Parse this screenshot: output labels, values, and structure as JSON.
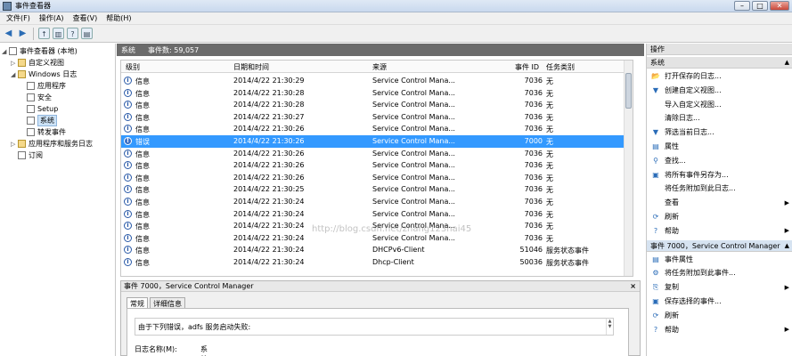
{
  "window": {
    "title": "事件查看器"
  },
  "menu": [
    "文件(F)",
    "操作(A)",
    "查看(V)",
    "帮助(H)"
  ],
  "tree": [
    {
      "label": "事件查看器 (本地)",
      "indent": 0,
      "exp": "◢",
      "icon": "log"
    },
    {
      "label": "自定义视图",
      "indent": 1,
      "exp": "▷",
      "icon": "fold"
    },
    {
      "label": "Windows 日志",
      "indent": 1,
      "exp": "◢",
      "icon": "fold"
    },
    {
      "label": "应用程序",
      "indent": 2,
      "exp": "",
      "icon": "log"
    },
    {
      "label": "安全",
      "indent": 2,
      "exp": "",
      "icon": "log"
    },
    {
      "label": "Setup",
      "indent": 2,
      "exp": "",
      "icon": "log"
    },
    {
      "label": "系统",
      "indent": 2,
      "exp": "",
      "icon": "log",
      "selected": true
    },
    {
      "label": "转发事件",
      "indent": 2,
      "exp": "",
      "icon": "log"
    },
    {
      "label": "应用程序和服务日志",
      "indent": 1,
      "exp": "▷",
      "icon": "fold"
    },
    {
      "label": "订阅",
      "indent": 1,
      "exp": "",
      "icon": "log"
    }
  ],
  "log": {
    "name": "系统",
    "count_label": "事件数: 59,057"
  },
  "columns": {
    "level": "级别",
    "datetime": "日期和时间",
    "source": "来源",
    "eventid": "事件 ID",
    "category": "任务类别"
  },
  "rows": [
    {
      "level": "信息",
      "datetime": "2014/4/22 21:30:29",
      "source": "Service Control Mana...",
      "eventid": "7036",
      "category": "无"
    },
    {
      "level": "信息",
      "datetime": "2014/4/22 21:30:28",
      "source": "Service Control Mana...",
      "eventid": "7036",
      "category": "无"
    },
    {
      "level": "信息",
      "datetime": "2014/4/22 21:30:28",
      "source": "Service Control Mana...",
      "eventid": "7036",
      "category": "无"
    },
    {
      "level": "信息",
      "datetime": "2014/4/22 21:30:27",
      "source": "Service Control Mana...",
      "eventid": "7036",
      "category": "无"
    },
    {
      "level": "信息",
      "datetime": "2014/4/22 21:30:26",
      "source": "Service Control Mana...",
      "eventid": "7036",
      "category": "无"
    },
    {
      "level": "错误",
      "datetime": "2014/4/22 21:30:26",
      "source": "Service Control Mana...",
      "eventid": "7000",
      "category": "无",
      "selected": true
    },
    {
      "level": "信息",
      "datetime": "2014/4/22 21:30:26",
      "source": "Service Control Mana...",
      "eventid": "7036",
      "category": "无"
    },
    {
      "level": "信息",
      "datetime": "2014/4/22 21:30:26",
      "source": "Service Control Mana...",
      "eventid": "7036",
      "category": "无"
    },
    {
      "level": "信息",
      "datetime": "2014/4/22 21:30:26",
      "source": "Service Control Mana...",
      "eventid": "7036",
      "category": "无"
    },
    {
      "level": "信息",
      "datetime": "2014/4/22 21:30:25",
      "source": "Service Control Mana...",
      "eventid": "7036",
      "category": "无"
    },
    {
      "level": "信息",
      "datetime": "2014/4/22 21:30:24",
      "source": "Service Control Mana...",
      "eventid": "7036",
      "category": "无"
    },
    {
      "level": "信息",
      "datetime": "2014/4/22 21:30:24",
      "source": "Service Control Mana...",
      "eventid": "7036",
      "category": "无"
    },
    {
      "level": "信息",
      "datetime": "2014/4/22 21:30:24",
      "source": "Service Control Mana...",
      "eventid": "7036",
      "category": "无"
    },
    {
      "level": "信息",
      "datetime": "2014/4/22 21:30:24",
      "source": "Service Control Mana...",
      "eventid": "7036",
      "category": "无"
    },
    {
      "level": "信息",
      "datetime": "2014/4/22 21:30:24",
      "source": "DHCPv6-Client",
      "eventid": "51046",
      "category": "服务状态事件"
    },
    {
      "level": "信息",
      "datetime": "2014/4/22 21:30:24",
      "source": "Dhcp-Client",
      "eventid": "50036",
      "category": "服务状态事件"
    }
  ],
  "detail": {
    "title": "事件 7000，Service Control Manager",
    "close": "×",
    "tabs": [
      "常规",
      "详细信息"
    ],
    "message": "由于下列错误，adfs 服务启动失败:",
    "field_label": "日志名称(M):",
    "field_value": "系统"
  },
  "watermark": "http://blog.csdn.net/zhang123hai45",
  "actions": {
    "header": "操作",
    "sec1_title": "系统",
    "sec1": [
      {
        "label": "打开保存的日志...",
        "icon": "📂"
      },
      {
        "label": "创建自定义视图...",
        "icon": "▼"
      },
      {
        "label": "导入自定义视图...",
        "icon": ""
      },
      {
        "label": "清除日志...",
        "icon": ""
      },
      {
        "label": "筛选当前日志...",
        "icon": "▼"
      },
      {
        "label": "属性",
        "icon": "▤"
      },
      {
        "label": "查找...",
        "icon": "⚲"
      },
      {
        "label": "将所有事件另存为...",
        "icon": "▣"
      },
      {
        "label": "将任务附加到此日志...",
        "icon": ""
      },
      {
        "label": "查看",
        "icon": "",
        "submenu": true
      },
      {
        "label": "刷新",
        "icon": "⟳"
      },
      {
        "label": "帮助",
        "icon": "?",
        "submenu": true
      }
    ],
    "sec2_title": "事件 7000，Service Control Manager",
    "sec2": [
      {
        "label": "事件属性",
        "icon": "▤"
      },
      {
        "label": "将任务附加到此事件...",
        "icon": "⚙"
      },
      {
        "label": "复制",
        "icon": "⎘",
        "submenu": true
      },
      {
        "label": "保存选择的事件...",
        "icon": "▣"
      },
      {
        "label": "刷新",
        "icon": "⟳"
      },
      {
        "label": "帮助",
        "icon": "?",
        "submenu": true
      }
    ]
  }
}
